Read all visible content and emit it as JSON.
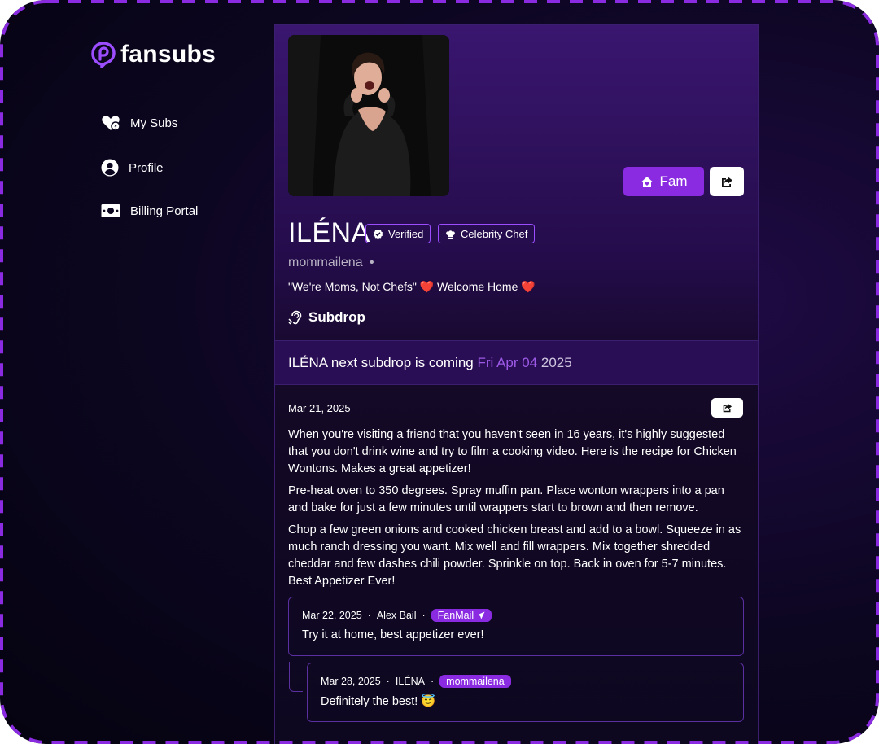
{
  "brand": {
    "name": "fansubs",
    "accent": "#8a2be2"
  },
  "sidebar": {
    "items": [
      {
        "label": "My Subs",
        "icon": "heart-icon"
      },
      {
        "label": "Profile",
        "icon": "user-circle-icon"
      },
      {
        "label": "Billing Portal",
        "icon": "money-bill-icon"
      }
    ]
  },
  "profile": {
    "name": "ILÉNA",
    "badges": [
      {
        "label": "Verified",
        "icon": "verified-check-icon"
      },
      {
        "label": "Celebrity Chef",
        "icon": "chef-hat-icon"
      }
    ],
    "handle": "mommailena",
    "handle_separator": "•",
    "bio": "\"We're Moms, Not Chefs\" ❤️ Welcome Home ❤️",
    "fam_button": "Fam",
    "subdrop_label": "Subdrop"
  },
  "banner": {
    "prefix": "ILÉNA next subdrop is coming ",
    "date": "Fri Apr 04",
    "year": " 2025"
  },
  "post": {
    "date": "Mar 21, 2025",
    "paragraphs": [
      "When you're visiting a friend that you haven't seen in 16 years, it's highly suggested that you don't drink wine and try to film a cooking video. Here is the recipe for Chicken Wontons. Makes a great appetizer!",
      "Pre-heat oven to 350 degrees. Spray muffin pan. Place wonton wrappers into a pan and bake for just a few minutes until wrappers start to brown and then remove.",
      "Chop a few green onions and cooked chicken breast and add to a bowl. Squeeze in as much ranch dressing you want. Mix well and fill wrappers. Mix together shredded cheddar and few dashes chili powder. Sprinkle on top. Back in oven for 5-7 minutes. Best Appetizer Ever!"
    ]
  },
  "comments": [
    {
      "date": "Mar 22, 2025",
      "author": "Alex Bail",
      "tag": "FanMail",
      "tag_icon": "paper-plane-icon",
      "text": "Try it at home, best appetizer ever!"
    },
    {
      "date": "Mar 28, 2025",
      "author": "ILÉNA",
      "tag": "mommailena",
      "text": "Definitely the best! 😇"
    }
  ],
  "separator": "·"
}
